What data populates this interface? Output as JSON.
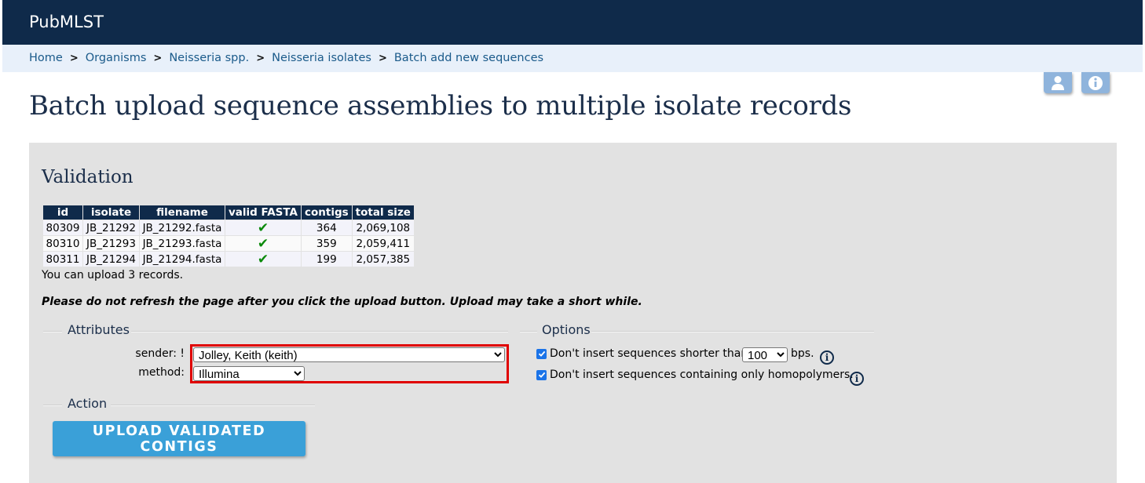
{
  "header": {
    "brand": "PubMLST"
  },
  "breadcrumb": {
    "items": [
      "Home",
      "Organisms",
      "Neisseria spp.",
      "Neisseria isolates",
      "Batch add new sequences"
    ],
    "separator": ">"
  },
  "icons": {
    "user": "user-icon",
    "info": "info-icon"
  },
  "page": {
    "title": "Batch upload sequence assemblies to multiple isolate records"
  },
  "validation": {
    "heading": "Validation",
    "columns": [
      "id",
      "isolate",
      "filename",
      "valid FASTA",
      "contigs",
      "total size"
    ],
    "rows": [
      [
        "80309",
        "JB_21292",
        "JB_21292.fasta",
        "✔",
        "364",
        "2,069,108"
      ],
      [
        "80310",
        "JB_21293",
        "JB_21293.fasta",
        "✔",
        "359",
        "2,059,411"
      ],
      [
        "80311",
        "JB_21294",
        "JB_21294.fasta",
        "✔",
        "199",
        "2,057,385"
      ]
    ],
    "upload_note": "You can upload 3 records.",
    "warning": "Please do not refresh the page after you click the upload button. Upload may take a short while."
  },
  "attributes": {
    "legend": "Attributes",
    "sender_label": "sender: !",
    "sender_value": "Jolley, Keith (keith)",
    "method_label": "method:",
    "method_value": "Illumina"
  },
  "options": {
    "legend": "Options",
    "min_length_prefix": "Don't insert sequences shorter than",
    "min_length_value": "100",
    "min_length_suffix": "bps.",
    "homopolymer_label": "Don't insert sequences containing only homopolymers.",
    "min_length_checked": true,
    "homopolymer_checked": true
  },
  "action": {
    "legend": "Action",
    "button_label": "UPLOAD VALIDATED CONTIGS"
  },
  "colors": {
    "header_bg": "#0f2a4a",
    "breadcrumb_bg": "#e8f0fa",
    "panel_bg": "#e2e2e2",
    "button_bg": "#3aa0d8",
    "highlight": "#e00000"
  }
}
